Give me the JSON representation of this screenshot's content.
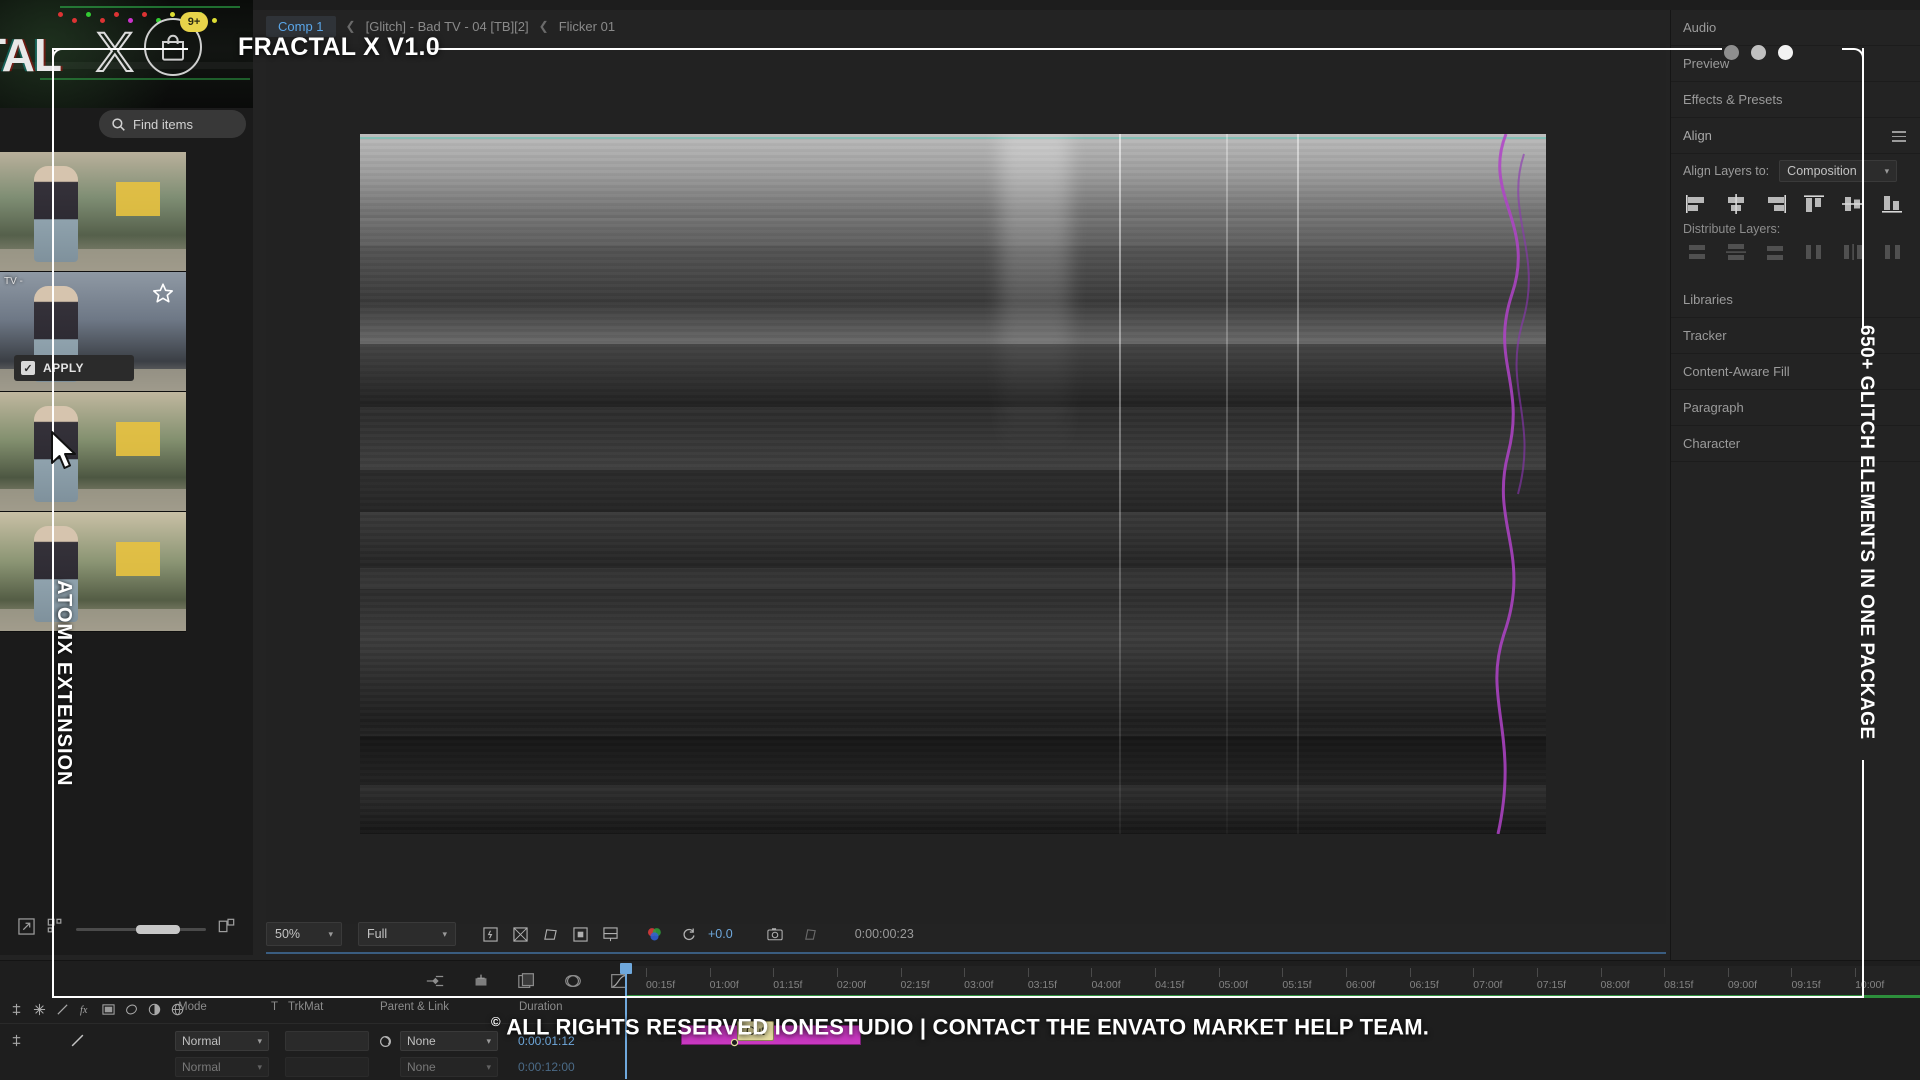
{
  "promo": {
    "title": "FRACTAL X V1.0",
    "footer_symbol": "©",
    "footer": "ALL RIGHTS RESERVED IONESTUDIO | CONTACT THE ENVATO MARKET HELP TEAM.",
    "vertical_left": "ATOMX EXTENSION",
    "vertical_right": "650+ GLITCH ELEMENTS IN ONE PACKAGE",
    "accent_white": "#ffffff",
    "dots": [
      "#8e8e8e",
      "#c0c0c0",
      "#f2f2f2"
    ]
  },
  "extension": {
    "hero_word": "TAL",
    "hero_x": "X",
    "cart_badge": "9+",
    "search_placeholder": "Find items",
    "search_icon": "search-icon",
    "thumb_label": "TV -",
    "apply_label": "APPLY",
    "apply_check": "✓",
    "favorite_icon": "star-icon",
    "thumbnails": [
      {
        "id": "thumb-1"
      },
      {
        "id": "thumb-2"
      },
      {
        "id": "thumb-3"
      },
      {
        "id": "thumb-4"
      }
    ],
    "footer_icons": [
      "expand-icon",
      "grid-icon",
      "layout-icon"
    ]
  },
  "breadcrumb": {
    "active": "Comp 1",
    "sep": "❮",
    "items": [
      "[Glitch] - Bad TV - 04 [TB][2]",
      "Flicker 01"
    ]
  },
  "viewer_toolbar": {
    "zoom": "50%",
    "resolution": "Full",
    "exposure": "+0.0",
    "timecode": "0:00:00:23",
    "icons": [
      "region-of-interest-icon",
      "transparency-grid-icon",
      "mask-icon",
      "title-safe-icon",
      "3d-view-icon",
      "channels-icon",
      "reset-exposure-icon",
      "snapshot-icon",
      "show-snapshot-icon"
    ]
  },
  "right_panel": {
    "rows": [
      {
        "label": "Audio"
      },
      {
        "label": "Preview"
      },
      {
        "label": "Effects & Presets"
      },
      {
        "label": "Align",
        "menu": true
      }
    ],
    "align_layers_to_label": "Align Layers to:",
    "align_layers_to_value": "Composition",
    "align_icons": [
      "align-left-icon",
      "align-horizontal-center-icon",
      "align-right-icon",
      "align-top-icon",
      "align-vertical-center-icon",
      "align-bottom-icon"
    ],
    "distribute_label": "Distribute Layers:",
    "distribute_icons": [
      "distribute-top-icon",
      "distribute-vertical-center-icon",
      "distribute-bottom-icon",
      "distribute-left-icon",
      "distribute-horizontal-center-icon",
      "distribute-right-icon"
    ],
    "rows_lower": [
      {
        "label": "Libraries"
      },
      {
        "label": "Tracker"
      },
      {
        "label": "Content-Aware Fill"
      },
      {
        "label": "Paragraph"
      },
      {
        "label": "Character"
      }
    ]
  },
  "timeline": {
    "toolbar_icons": [
      "keyframe-navigator-icon",
      "motion-blur-icon",
      "layers-icon",
      "shy-icon",
      "graph-editor-icon"
    ],
    "columns": [
      "Mode",
      "T",
      "TrkMat",
      "Parent & Link",
      "Duration"
    ],
    "layer_icons": [
      "shy-icon",
      "effects-icon",
      "motion-blur-icon",
      "fx-icon",
      "adjustment-layer-icon",
      "audio-icon",
      "solo-icon",
      "3d-layer-icon"
    ],
    "rows": [
      {
        "mode": "Normal",
        "trkmat": "",
        "parent": "None",
        "duration": "0:00:01:12"
      },
      {
        "mode": "Normal",
        "trkmat": "",
        "parent": "None",
        "duration": "0:00:12:00"
      }
    ],
    "parent_icon": "pickwhip-icon",
    "clip_marker": "Cut",
    "ruler_ticks": [
      "00:15f",
      "01:00f",
      "01:15f",
      "02:00f",
      "02:15f",
      "03:00f",
      "03:15f",
      "04:00f",
      "04:15f",
      "05:00f",
      "05:15f",
      "06:00f",
      "06:15f",
      "07:00f",
      "07:15f",
      "08:00f",
      "08:15f",
      "09:00f",
      "09:15f",
      "10:00f"
    ]
  }
}
